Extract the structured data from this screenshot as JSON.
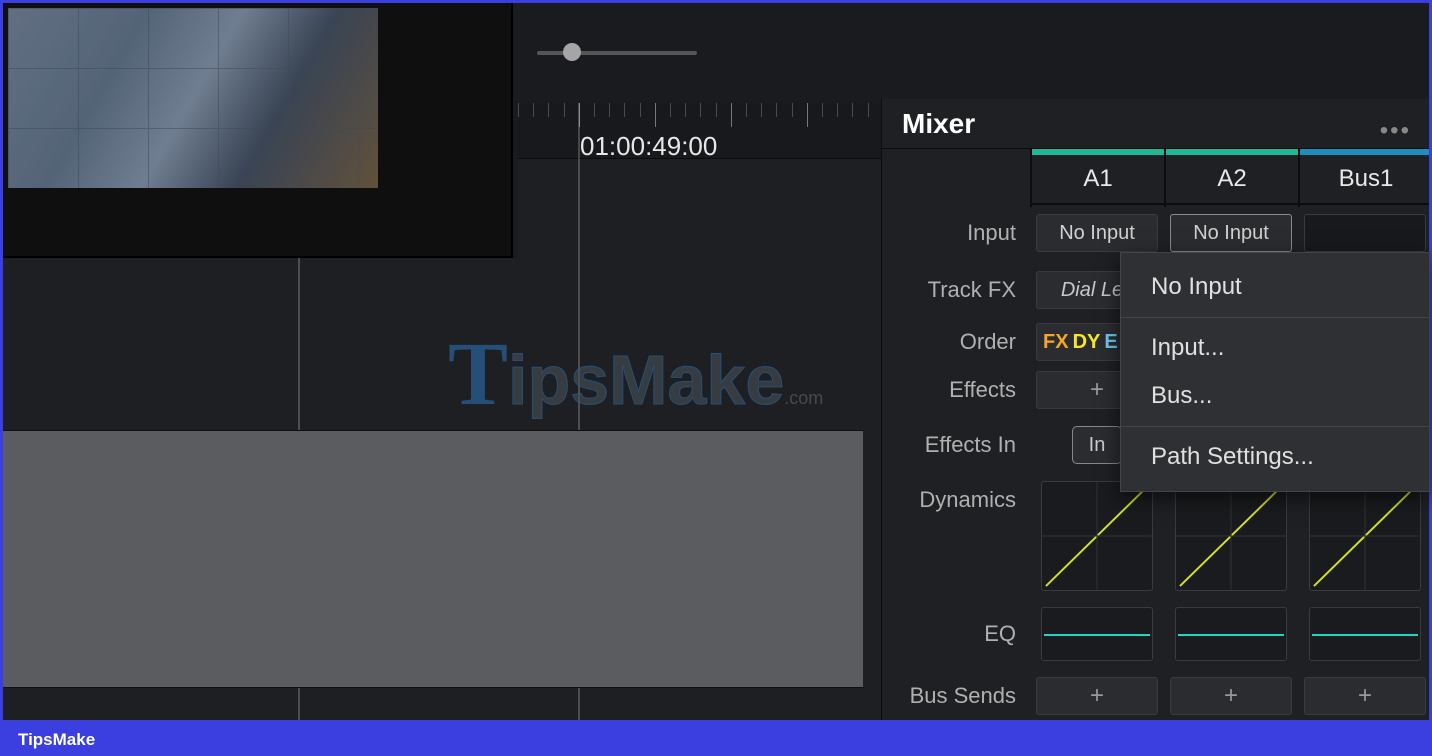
{
  "timeline": {
    "timecode": "01:00:49:00"
  },
  "mixer": {
    "title": "Mixer",
    "labels": {
      "input": "Input",
      "track_fx": "Track FX",
      "order": "Order",
      "effects": "Effects",
      "effects_in": "Effects In",
      "dynamics": "Dynamics",
      "eq": "EQ",
      "bus_sends": "Bus Sends"
    },
    "channels": [
      {
        "name": "A1",
        "strip_color": "#1fb894",
        "input": "No Input",
        "track_fx": "Dial Lev",
        "order": {
          "fx": "FX",
          "dy": "DY"
        },
        "effects": "+",
        "effects_in": "In"
      },
      {
        "name": "A2",
        "strip_color": "#1fb894",
        "input": "No Input",
        "effects_in": "..."
      },
      {
        "name": "Bus1",
        "strip_color": "#1a8fbf",
        "input": "",
        "effects_in": "..."
      }
    ]
  },
  "context_menu": {
    "items": [
      "No Input",
      "Input...",
      "Bus...",
      "Path Settings..."
    ]
  },
  "watermark": {
    "brand_t": "T",
    "brand_rest": "ipsMake",
    "brand_com": ".com"
  },
  "footer": "TipsMake"
}
